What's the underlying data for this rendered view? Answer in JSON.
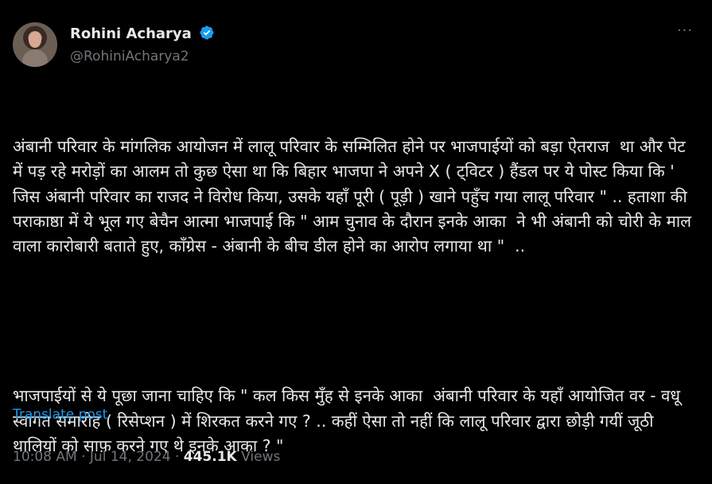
{
  "author": {
    "name": "Rohini Acharya",
    "handle": "@RohiniAcharya2",
    "verified": true,
    "verified_color": "#1d9bf0"
  },
  "menu": {
    "more_label": "···",
    "icon": "more-horizontal-icon"
  },
  "tweet": {
    "paragraph1": "अंबानी परिवार के मांगलिक आयोजन में लालू परिवार के सम्मिलित होने पर भाजपाईयों को बड़ा ऐतराज  था और पेट में पड़ रहे मरोड़ों का आलम तो कुछ ऐसा था कि बिहार भाजपा ने अपने X ( ट्विटर ) हैंडल पर ये पोस्ट किया कि ' जिस अंबानी परिवार का राजद ने विरोध किया, उसके यहाँ पूरी ( पूड़ी ) खाने पहुँच गया लालू परिवार \" .. हताशा की पराकाष्ठा में ये भूल गए बेचैन आत्मा भाजपाई कि \" आम चुनाव के दौरान इनके आका  ने भी अंबानी को चोरी के माल वाला कारोबारी बताते हुए, कॉंग्रेस - अंबानी के बीच डील होने का आरोप लगाया था \"  ..",
    "paragraph2": "भाजपाईयों से ये पूछा जाना चाहिए कि \" कल किस मुँह से इनके आका  अंबानी परिवार के यहाँ आयोजित वर - वधू स्वागत समारोह ( रिसेप्शन ) में शिरकत करने गए ? .. कहीं ऐसा तो नहीं कि लालू परिवार द्वारा छोड़ी गयीं जूठी थालियों को साफ़ करने गए थे इनके आका ? \""
  },
  "translate_label": "Translate post",
  "meta": {
    "time": "10:08 AM",
    "separator": "·",
    "date": "Jul 14, 2024",
    "views_count": "445.1K",
    "views_label": "Views"
  },
  "colors": {
    "background": "#000000",
    "text": "#e7e9ea",
    "muted": "#71767b",
    "link": "#1d9bf0"
  }
}
